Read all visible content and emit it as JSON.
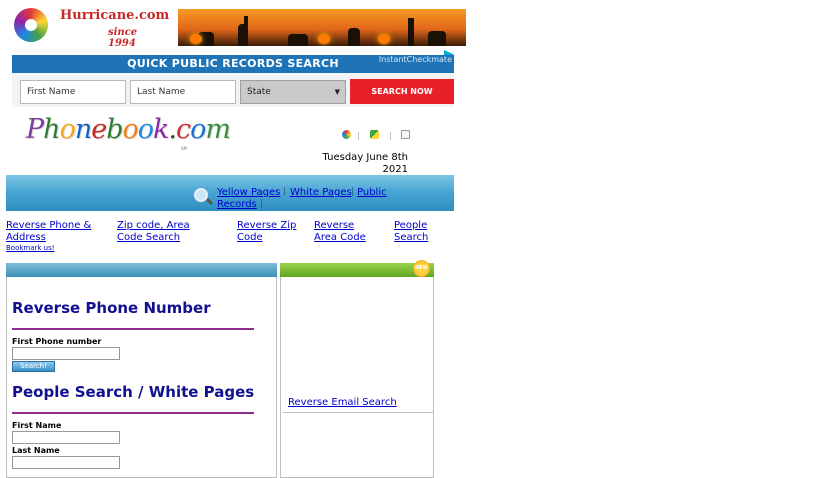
{
  "header": {
    "site_name": "Hurricane.com",
    "since": "since 1994"
  },
  "quick_search": {
    "title": "QUICK PUBLIC RECORDS SEARCH",
    "brand": "InstantCheckmate",
    "first_name_placeholder": "First Name",
    "last_name_placeholder": "Last Name",
    "state_value": "State",
    "button_label": "SEARCH NOW",
    "button_color": "#e8202a"
  },
  "phonebook": {
    "logo_letters": [
      "P",
      "h",
      "o",
      "n",
      "e",
      "b",
      "o",
      "o",
      "k",
      ".",
      "c",
      "o",
      "m"
    ],
    "logo_colors": [
      "#7b3fa0",
      "#2e7d32",
      "#f9a825",
      "#1565c0",
      "#c62828",
      "#2e7d32",
      "#f57f17",
      "#1e88e5",
      "#8e24aa",
      "#444444",
      "#d32f2f",
      "#1976d2",
      "#388e3c"
    ],
    "tm": "SM",
    "date_line1": "Tuesday June 8th",
    "date_line2": "2021"
  },
  "nav": {
    "yellow_pages": "Yellow Pages",
    "white_pages": "White Pages",
    "public_records_1": "Public",
    "public_records_2": "Records",
    "separator": "|"
  },
  "quick_links": [
    {
      "line1": "Reverse Phone &",
      "line2": "Address"
    },
    {
      "line1": "Zip code, Area",
      "line2": "Code Search"
    },
    {
      "line1": "Reverse Zip",
      "line2": "Code"
    },
    {
      "line1": "Reverse",
      "line2": "Area Code"
    },
    {
      "line1": "People",
      "line2": "Search"
    }
  ],
  "bookmark": "Bookmark us!",
  "reverse_phone": {
    "title": "Reverse Phone Number",
    "field_label": "First Phone number",
    "button_label": "Search!"
  },
  "people_search": {
    "title": "People Search / White Pages",
    "first_name_label": "First Name",
    "last_name_label": "Last Name"
  },
  "right_panel": {
    "badge": "NEW",
    "reverse_email": "Reverse Email Search"
  }
}
